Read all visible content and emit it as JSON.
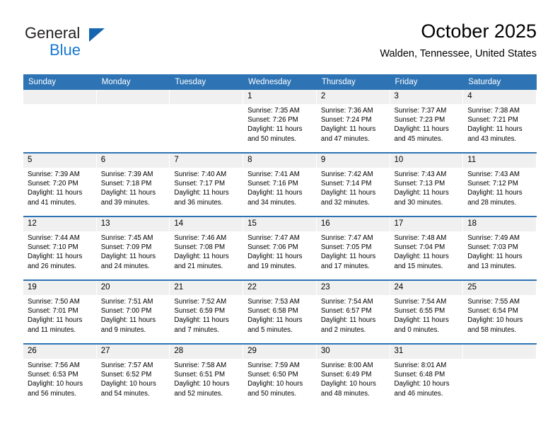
{
  "logo": {
    "word_top": "General",
    "word_bottom": "Blue",
    "triangle_icon": "blue-triangle-icon",
    "accent_dark": "#1565b0",
    "accent_light": "#1879d0"
  },
  "header": {
    "title": "October 2025",
    "subtitle": "Walden, Tennessee, United States"
  },
  "colors": {
    "header_band": "#2e74b5",
    "date_band": "#f0f0f0",
    "text": "#000000"
  },
  "calendar": {
    "day_headers": [
      "Sunday",
      "Monday",
      "Tuesday",
      "Wednesday",
      "Thursday",
      "Friday",
      "Saturday"
    ],
    "labels": {
      "sunrise": "Sunrise:",
      "sunset": "Sunset:",
      "daylight": "Daylight:"
    },
    "weeks": [
      [
        {
          "day": "",
          "lines": []
        },
        {
          "day": "",
          "lines": []
        },
        {
          "day": "",
          "lines": []
        },
        {
          "day": "1",
          "lines": [
            "Sunrise: 7:35 AM",
            "Sunset: 7:26 PM",
            "Daylight: 11 hours",
            "and 50 minutes."
          ]
        },
        {
          "day": "2",
          "lines": [
            "Sunrise: 7:36 AM",
            "Sunset: 7:24 PM",
            "Daylight: 11 hours",
            "and 47 minutes."
          ]
        },
        {
          "day": "3",
          "lines": [
            "Sunrise: 7:37 AM",
            "Sunset: 7:23 PM",
            "Daylight: 11 hours",
            "and 45 minutes."
          ]
        },
        {
          "day": "4",
          "lines": [
            "Sunrise: 7:38 AM",
            "Sunset: 7:21 PM",
            "Daylight: 11 hours",
            "and 43 minutes."
          ]
        }
      ],
      [
        {
          "day": "5",
          "lines": [
            "Sunrise: 7:39 AM",
            "Sunset: 7:20 PM",
            "Daylight: 11 hours",
            "and 41 minutes."
          ]
        },
        {
          "day": "6",
          "lines": [
            "Sunrise: 7:39 AM",
            "Sunset: 7:18 PM",
            "Daylight: 11 hours",
            "and 39 minutes."
          ]
        },
        {
          "day": "7",
          "lines": [
            "Sunrise: 7:40 AM",
            "Sunset: 7:17 PM",
            "Daylight: 11 hours",
            "and 36 minutes."
          ]
        },
        {
          "day": "8",
          "lines": [
            "Sunrise: 7:41 AM",
            "Sunset: 7:16 PM",
            "Daylight: 11 hours",
            "and 34 minutes."
          ]
        },
        {
          "day": "9",
          "lines": [
            "Sunrise: 7:42 AM",
            "Sunset: 7:14 PM",
            "Daylight: 11 hours",
            "and 32 minutes."
          ]
        },
        {
          "day": "10",
          "lines": [
            "Sunrise: 7:43 AM",
            "Sunset: 7:13 PM",
            "Daylight: 11 hours",
            "and 30 minutes."
          ]
        },
        {
          "day": "11",
          "lines": [
            "Sunrise: 7:43 AM",
            "Sunset: 7:12 PM",
            "Daylight: 11 hours",
            "and 28 minutes."
          ]
        }
      ],
      [
        {
          "day": "12",
          "lines": [
            "Sunrise: 7:44 AM",
            "Sunset: 7:10 PM",
            "Daylight: 11 hours",
            "and 26 minutes."
          ]
        },
        {
          "day": "13",
          "lines": [
            "Sunrise: 7:45 AM",
            "Sunset: 7:09 PM",
            "Daylight: 11 hours",
            "and 24 minutes."
          ]
        },
        {
          "day": "14",
          "lines": [
            "Sunrise: 7:46 AM",
            "Sunset: 7:08 PM",
            "Daylight: 11 hours",
            "and 21 minutes."
          ]
        },
        {
          "day": "15",
          "lines": [
            "Sunrise: 7:47 AM",
            "Sunset: 7:06 PM",
            "Daylight: 11 hours",
            "and 19 minutes."
          ]
        },
        {
          "day": "16",
          "lines": [
            "Sunrise: 7:47 AM",
            "Sunset: 7:05 PM",
            "Daylight: 11 hours",
            "and 17 minutes."
          ]
        },
        {
          "day": "17",
          "lines": [
            "Sunrise: 7:48 AM",
            "Sunset: 7:04 PM",
            "Daylight: 11 hours",
            "and 15 minutes."
          ]
        },
        {
          "day": "18",
          "lines": [
            "Sunrise: 7:49 AM",
            "Sunset: 7:03 PM",
            "Daylight: 11 hours",
            "and 13 minutes."
          ]
        }
      ],
      [
        {
          "day": "19",
          "lines": [
            "Sunrise: 7:50 AM",
            "Sunset: 7:01 PM",
            "Daylight: 11 hours",
            "and 11 minutes."
          ]
        },
        {
          "day": "20",
          "lines": [
            "Sunrise: 7:51 AM",
            "Sunset: 7:00 PM",
            "Daylight: 11 hours",
            "and 9 minutes."
          ]
        },
        {
          "day": "21",
          "lines": [
            "Sunrise: 7:52 AM",
            "Sunset: 6:59 PM",
            "Daylight: 11 hours",
            "and 7 minutes."
          ]
        },
        {
          "day": "22",
          "lines": [
            "Sunrise: 7:53 AM",
            "Sunset: 6:58 PM",
            "Daylight: 11 hours",
            "and 5 minutes."
          ]
        },
        {
          "day": "23",
          "lines": [
            "Sunrise: 7:54 AM",
            "Sunset: 6:57 PM",
            "Daylight: 11 hours",
            "and 2 minutes."
          ]
        },
        {
          "day": "24",
          "lines": [
            "Sunrise: 7:54 AM",
            "Sunset: 6:55 PM",
            "Daylight: 11 hours",
            "and 0 minutes."
          ]
        },
        {
          "day": "25",
          "lines": [
            "Sunrise: 7:55 AM",
            "Sunset: 6:54 PM",
            "Daylight: 10 hours",
            "and 58 minutes."
          ]
        }
      ],
      [
        {
          "day": "26",
          "lines": [
            "Sunrise: 7:56 AM",
            "Sunset: 6:53 PM",
            "Daylight: 10 hours",
            "and 56 minutes."
          ]
        },
        {
          "day": "27",
          "lines": [
            "Sunrise: 7:57 AM",
            "Sunset: 6:52 PM",
            "Daylight: 10 hours",
            "and 54 minutes."
          ]
        },
        {
          "day": "28",
          "lines": [
            "Sunrise: 7:58 AM",
            "Sunset: 6:51 PM",
            "Daylight: 10 hours",
            "and 52 minutes."
          ]
        },
        {
          "day": "29",
          "lines": [
            "Sunrise: 7:59 AM",
            "Sunset: 6:50 PM",
            "Daylight: 10 hours",
            "and 50 minutes."
          ]
        },
        {
          "day": "30",
          "lines": [
            "Sunrise: 8:00 AM",
            "Sunset: 6:49 PM",
            "Daylight: 10 hours",
            "and 48 minutes."
          ]
        },
        {
          "day": "31",
          "lines": [
            "Sunrise: 8:01 AM",
            "Sunset: 6:48 PM",
            "Daylight: 10 hours",
            "and 46 minutes."
          ]
        },
        {
          "day": "",
          "lines": []
        }
      ]
    ]
  }
}
